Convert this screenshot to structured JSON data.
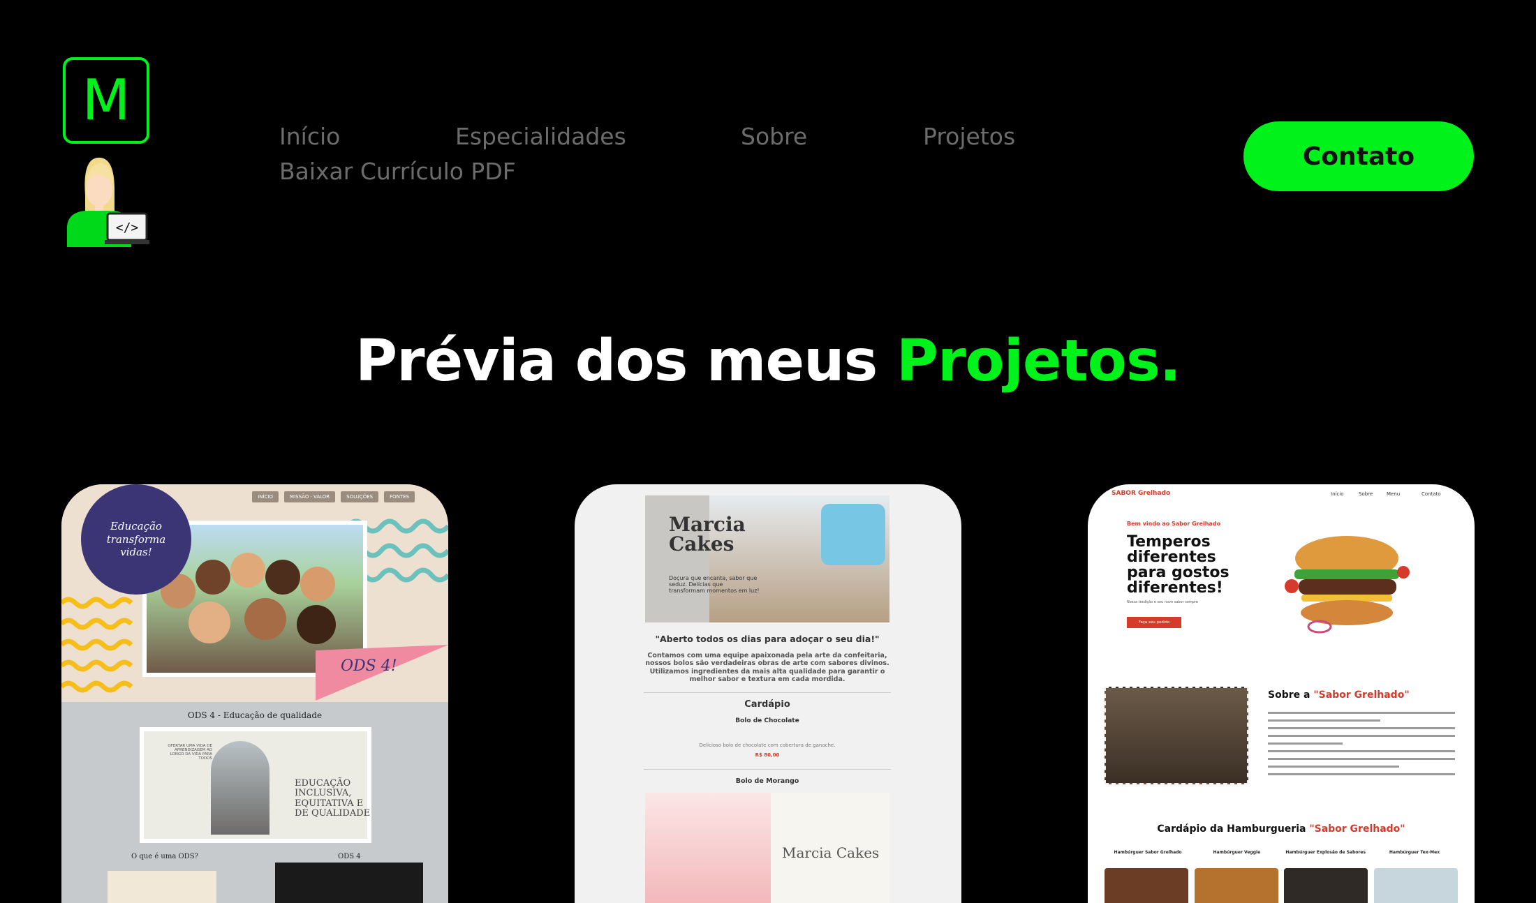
{
  "logo": {
    "letter": "M"
  },
  "nav": {
    "links": [
      "Início",
      "Especialidades",
      "Sobre",
      "Projetos",
      "Baixar Currículo PDF"
    ]
  },
  "contact_button": "Contato",
  "headline": {
    "part1": "Prévia dos meus",
    "part2": "Projetos."
  },
  "colors": {
    "accent": "#00f21b",
    "background": "#000000",
    "nav_text": "#6c6c6c"
  },
  "projects": [
    {
      "name": "ODS 4",
      "nav": [
        "INÍCIO",
        "MISSÃO · VALOR",
        "SOLUÇÕES",
        "FONTES"
      ],
      "badge": "Educação transforma vidas!",
      "flag": "ODS 4!",
      "subtitle": "ODS 4 - Educação de qualidade",
      "banner_small": "OFERTAR UMA VIDA DE APRENDIZAGEM AO LONGO DA VIDA PARA TODOS",
      "banner_title": "EDUCAÇÃO INCLUSIVA, EQUITATIVA E DE QUALIDADE",
      "q1": "O que é uma ODS?",
      "q2": "ODS 4"
    },
    {
      "name": "Marcia Cakes",
      "title": "Marcia Cakes",
      "tagline": "Doçura que encanta, sabor que seduz. Delícias que transformam momentos em luz!",
      "heading": "\"Aberto todos os dias para adoçar o seu dia!\"",
      "paragraph": "Contamos com uma equipe apaixonada pela arte da confeitaria, nossos bolos são verdadeiras obras de arte com sabores divinos. Utilizamos ingredientes da mais alta qualidade para garantir o melhor sabor e textura em cada mordida.",
      "menu_title": "Cardápio",
      "item1": "Bolo de Chocolate",
      "item1_desc": "Delicioso bolo de chocolate com cobertura de ganache.",
      "item1_price": "R$ 80,00",
      "item2": "Bolo de Morango",
      "image_text": "Marcia Cakes"
    },
    {
      "name": "Sabor Grelhado",
      "brand_prefix": "SABOR ",
      "brand_accent": "Grelhado",
      "nav": [
        "Início",
        "Sobre",
        "Menu",
        "Contato"
      ],
      "welcome": "Bem vindo ao Sabor Grelhado",
      "big": "Temperos diferentes para gostos diferentes!",
      "small": "Nossa tradição e seu novo sabor sempre",
      "button": "Faça seu pedido",
      "about_prefix": "Sobre a ",
      "about_accent": "\"Sabor Grelhado\"",
      "menu_prefix": "Cardápio da Hamburgueria ",
      "menu_accent": "\"Sabor Grelhado\"",
      "items": [
        "Hambúrguer Sabor Grelhado",
        "Hambúrguer Veggie",
        "Hambúrguer Explosão de Sabores",
        "Hambúrguer Tex-Mex"
      ]
    }
  ]
}
